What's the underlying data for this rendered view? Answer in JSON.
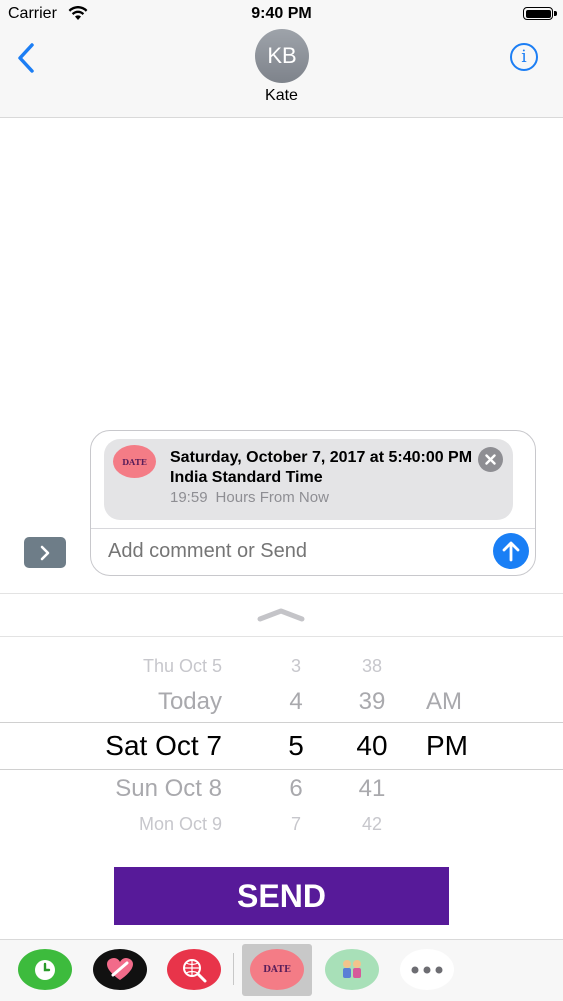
{
  "status_bar": {
    "carrier": "Carrier",
    "time": "9:40 PM"
  },
  "header": {
    "back_icon": "chevron-left-icon",
    "avatar_initials": "KB",
    "contact_name": "Kate",
    "info_icon": "info-icon",
    "info_glyph": "i"
  },
  "compose": {
    "card": {
      "badge": "DATE",
      "title": "Saturday, October 7, 2017 at 5:40:00 PM",
      "timezone": "India Standard Time",
      "offset": "19:59",
      "relative": "Hours From Now"
    },
    "placeholder": "Add comment or Send"
  },
  "picker": {
    "dates": [
      "Thu Oct 5",
      "Today",
      "Sat Oct 7",
      "Sun Oct 8",
      "Mon Oct 9"
    ],
    "hours": [
      "3",
      "4",
      "5",
      "6",
      "7"
    ],
    "minutes": [
      "38",
      "39",
      "40",
      "41",
      "42"
    ],
    "ampm": [
      "AM",
      "PM"
    ]
  },
  "send_button": "SEND",
  "app_drawer": {
    "apps": [
      {
        "name": "clock-app-icon",
        "color": "#3dbb3d"
      },
      {
        "name": "love-app-icon",
        "color": "#111111"
      },
      {
        "name": "globe-search-app-icon",
        "color": "#e8344a"
      },
      {
        "name": "date-app-icon",
        "color": "#f47c86",
        "label": "DATE",
        "selected": true
      },
      {
        "name": "people-app-icon",
        "color": "#a8e0b8"
      },
      {
        "name": "more-apps-icon",
        "color": "#ffffff"
      }
    ]
  },
  "colors": {
    "accent": "#1a7ff5",
    "send": "#571a99",
    "date_badge": "#f47c86"
  }
}
